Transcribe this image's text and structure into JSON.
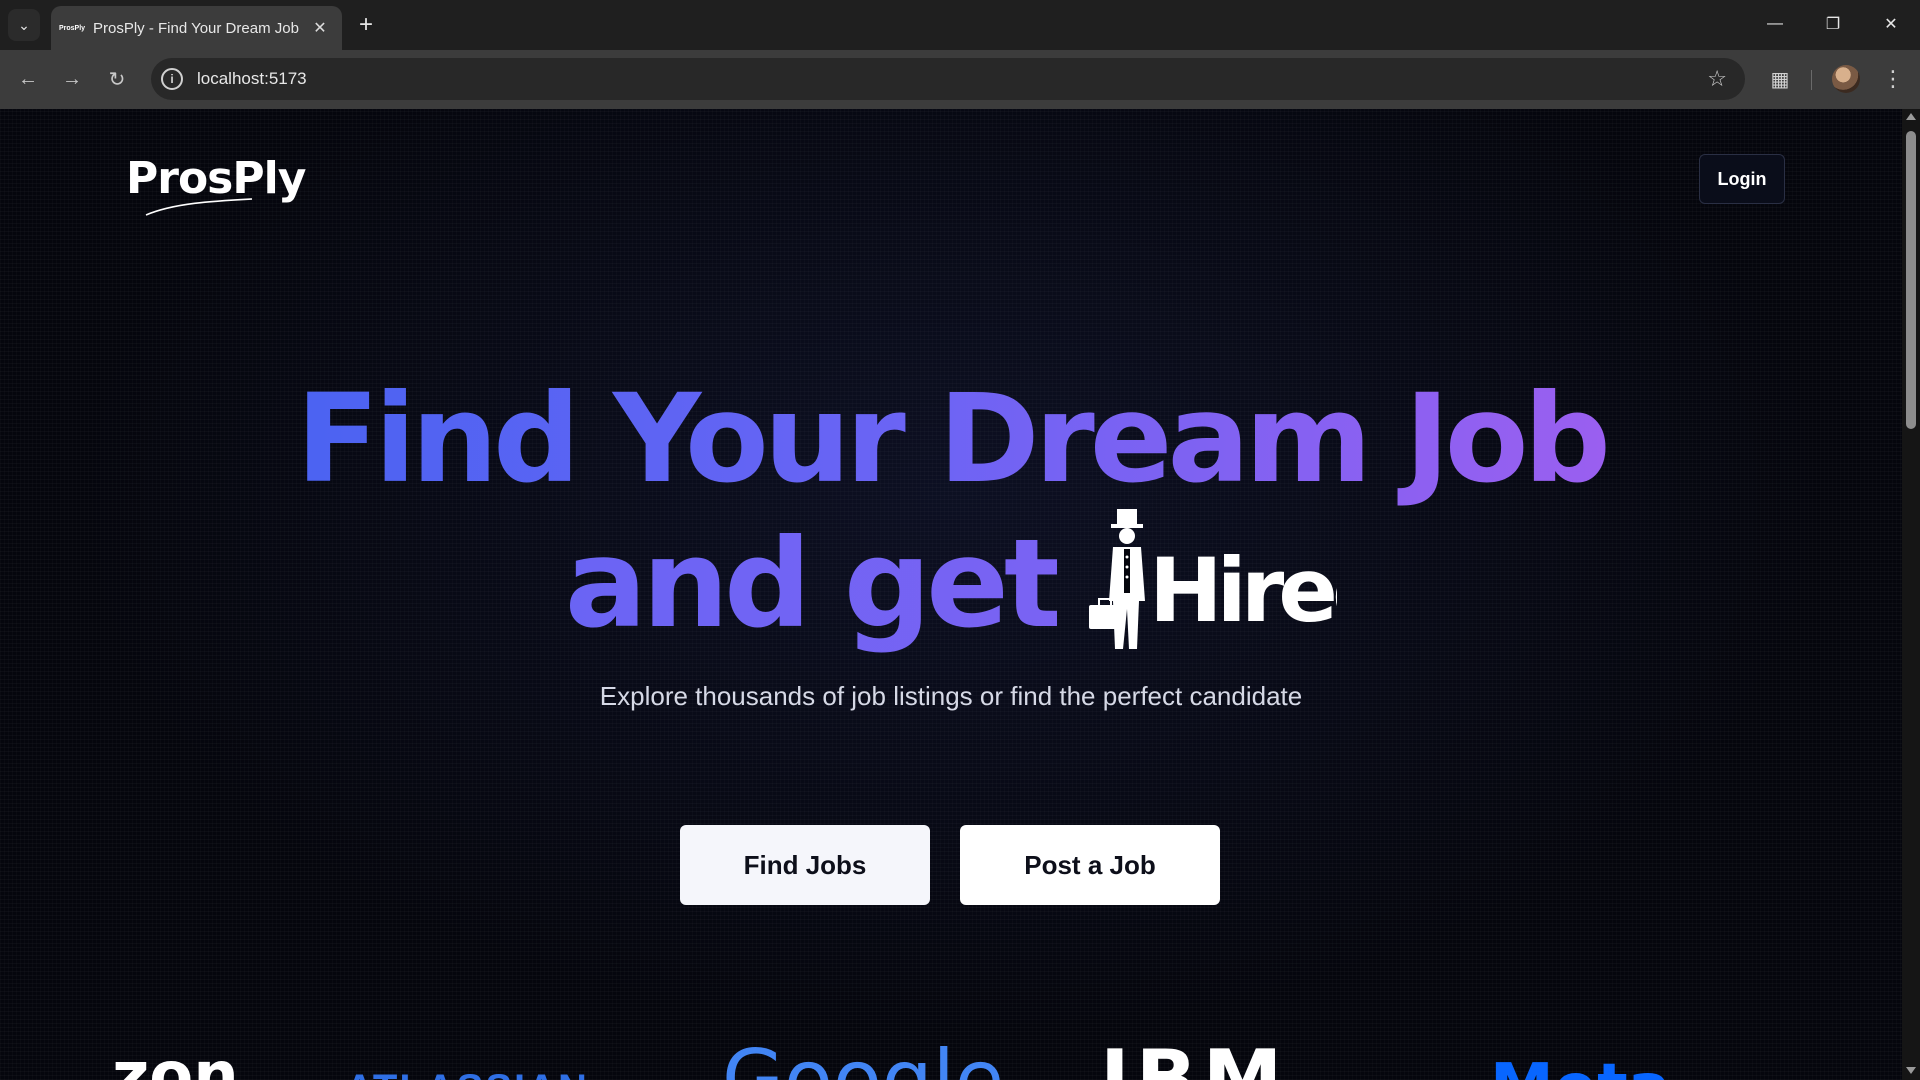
{
  "browser": {
    "tab_title": "ProsPly - Find Your Dream Job",
    "tab_favicon_text": "ProsPly",
    "url": "localhost:5173"
  },
  "header": {
    "logo_text": "ProsPly",
    "login_label": "Login"
  },
  "hero": {
    "line1": "Find Your Dream Job",
    "line2": "and get",
    "hired_logo_text": "Hired",
    "subtitle": "Explore thousands of job listings or find the perfect candidate"
  },
  "cta": {
    "find_jobs_label": "Find Jobs",
    "post_job_label": "Post a Job"
  },
  "companies": {
    "amazon": "zon",
    "atlassian": "ATLASSIAN",
    "google": "Google",
    "ibm": "IBM",
    "meta": "Meta"
  },
  "colors": {
    "accent_blue": "#4b63f2",
    "accent_purple": "#9a5ff0",
    "background": "#05060d"
  }
}
